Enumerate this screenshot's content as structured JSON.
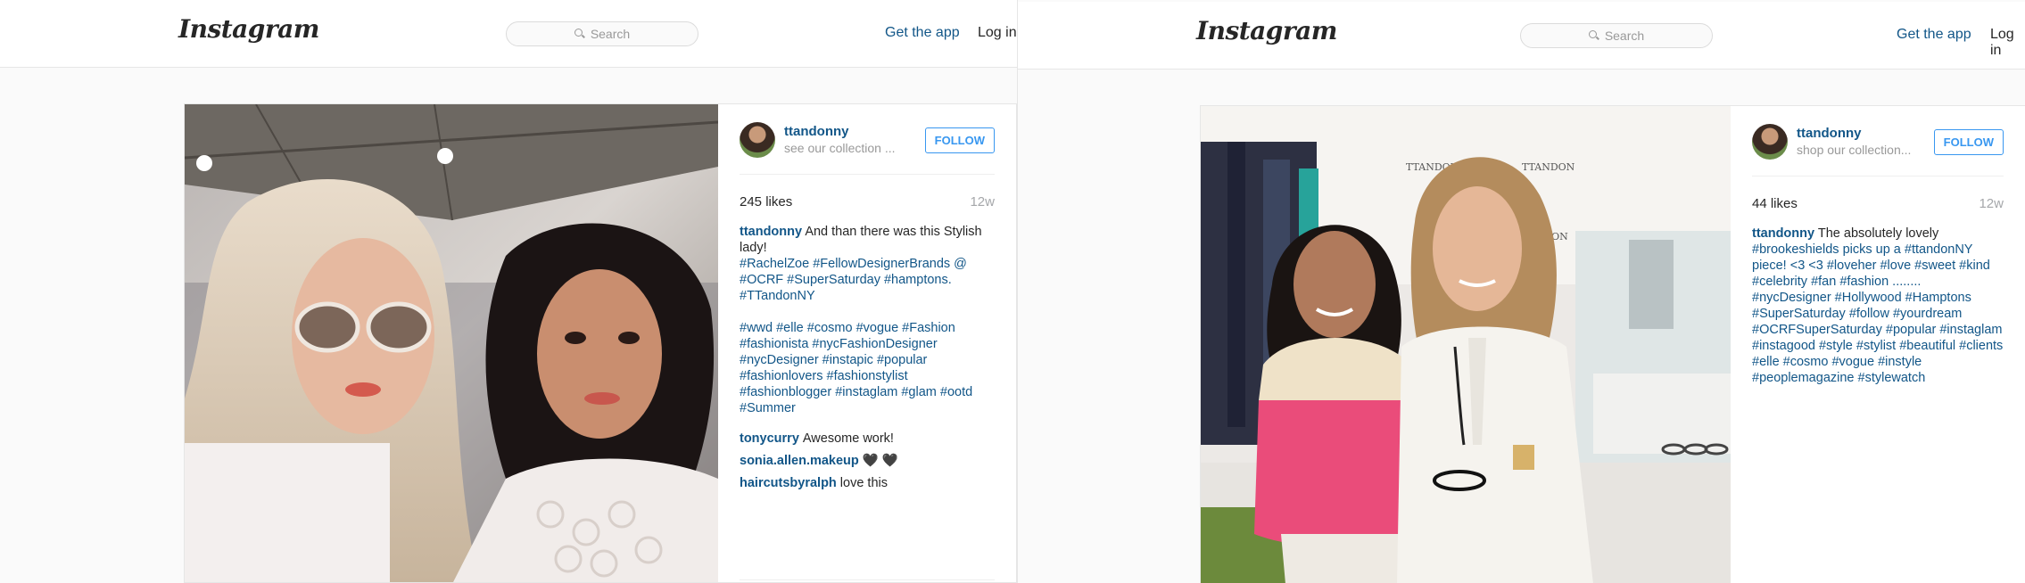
{
  "left": {
    "header": {
      "logo": "Instagram",
      "search_placeholder": "Search",
      "get_app": "Get the app",
      "login": "Log in"
    },
    "post": {
      "username": "ttandonny",
      "subtitle": "see our collection ...",
      "follow_label": "FOLLOW",
      "likes": "245 likes",
      "age": "12w",
      "caption_user": "ttandonny",
      "caption_text": "And than there was this Stylish lady!",
      "caption_tags_1": "#RachelZoe #FellowDesignerBrands @ #OCRF #SuperSaturday #hamptons. #TTandonNY",
      "caption_tags_2": "#wwd #elle #cosmo #vogue #Fashion #fashionista #nycFashionDesigner #nycDesigner #instapic #popular #fashionlovers #fashionstylist #fashionblogger #instaglam #glam #ootd #Summer",
      "comments": [
        {
          "user": "tonycurry",
          "text": "Awesome work!"
        },
        {
          "user": "sonia.allen.makeup",
          "text": "🖤 🖤"
        },
        {
          "user": "haircutsbyralph",
          "text": "love this"
        }
      ]
    }
  },
  "right": {
    "header": {
      "logo": "Instagram",
      "search_placeholder": "Search",
      "get_app": "Get the app",
      "login": "Log in"
    },
    "post": {
      "username": "ttandonny",
      "subtitle": "shop our collection...",
      "follow_label": "FOLLOW",
      "likes": "44 likes",
      "age": "12w",
      "caption_user": "ttandonny",
      "caption_text": "The absolutely lovely",
      "caption_rest": "#brookeshields picks up a #ttandonNY piece! <3 <3 #loveher #love #sweet #kind #celebrity #fan #fashion ........ #nycDesigner #Hollywood #Hamptons #SuperSaturday #follow #yourdream #OCRFSuperSaturday #popular #instaglam #instagood #style #stylist #beautiful #clients #elle #cosmo #vogue #instyle #peoplemagazine #stylewatch"
    },
    "photo_signage": [
      "TTANDON",
      "TTANDON",
      "TANDON"
    ]
  }
}
